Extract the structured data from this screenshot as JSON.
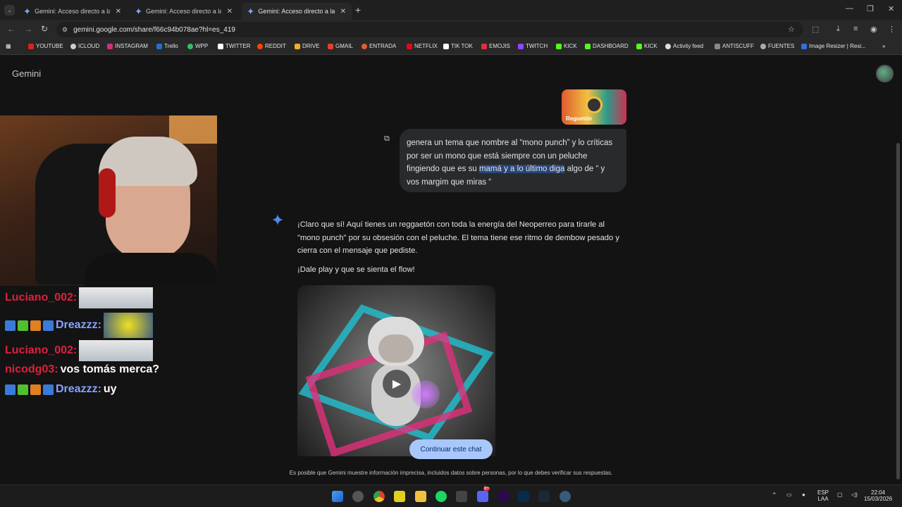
{
  "tabs": [
    {
      "title": "Gemini: Acceso directo a la IA d",
      "active": false
    },
    {
      "title": "Gemini: Acceso directo a la IA d",
      "active": false
    },
    {
      "title": "Gemini: Acceso directo a la IA d",
      "active": true
    }
  ],
  "address": {
    "url": "gemini.google.com/share/f66c94b078ae?hl=es_419"
  },
  "bookmarks": [
    "YOUTUBE",
    "ICLOUD",
    "INSTAGRAM",
    "Trello",
    "WPP",
    "TWITTER",
    "REDDIT",
    "DRIVE",
    "GMAIL",
    "ENTRADA",
    "NETFLIX",
    "TIK TOK",
    "EMOJIS",
    "TWITCH",
    "KICK",
    "DASHBOARD",
    "KICK",
    "Activity feed",
    "ANTISCUFF",
    "FUENTES",
    "Image Resizer | Resi..."
  ],
  "app": {
    "title": "Gemini"
  },
  "chat_overlay": [
    {
      "user": "Luciano_002:",
      "message": "",
      "color": "#e0203a"
    },
    {
      "user": "Dreazzz:",
      "message": "",
      "color": "#8aa0ff"
    },
    {
      "user": "Luciano_002:",
      "message": "",
      "color": "#e0203a"
    },
    {
      "user": "nicodg03:",
      "message": "vos tomás merca?",
      "color": "#e0203a"
    },
    {
      "user": "Dreazzz:",
      "message": "uy",
      "color": "#8aa0ff"
    }
  ],
  "conversation": {
    "attachment_label": "Reguetón",
    "prompt_before": "genera un tema que nombre al “mono punch” y lo críticas por ser un mono que está siempre con un peluche fingiendo que es su ",
    "prompt_selected": "mamá y a lo último diga",
    "prompt_after": " algo de “ y vos margim que miras “",
    "reply_1": "¡Claro que sí! Aquí tienes un reggaetón con toda la energía del Neoperreo para tirarle al \"mono punch\" por su obsesión con el peluche. El tema tiene ese ritmo de dembow pesado y cierra con el mensaje que pediste.",
    "reply_2": "¡Dale play y que se sienta el flow!",
    "continue_label": "Continuar este chat",
    "disclaimer": "Es posible que Gemini muestre información imprecisa, incluidos datos sobre personas, por lo que debes verificar sus respuestas."
  },
  "taskbar": {
    "lang_top": "ESP",
    "lang_bottom": "LAA",
    "time": "22:04",
    "date": "15/03/2026",
    "discord_badge": "9+"
  }
}
